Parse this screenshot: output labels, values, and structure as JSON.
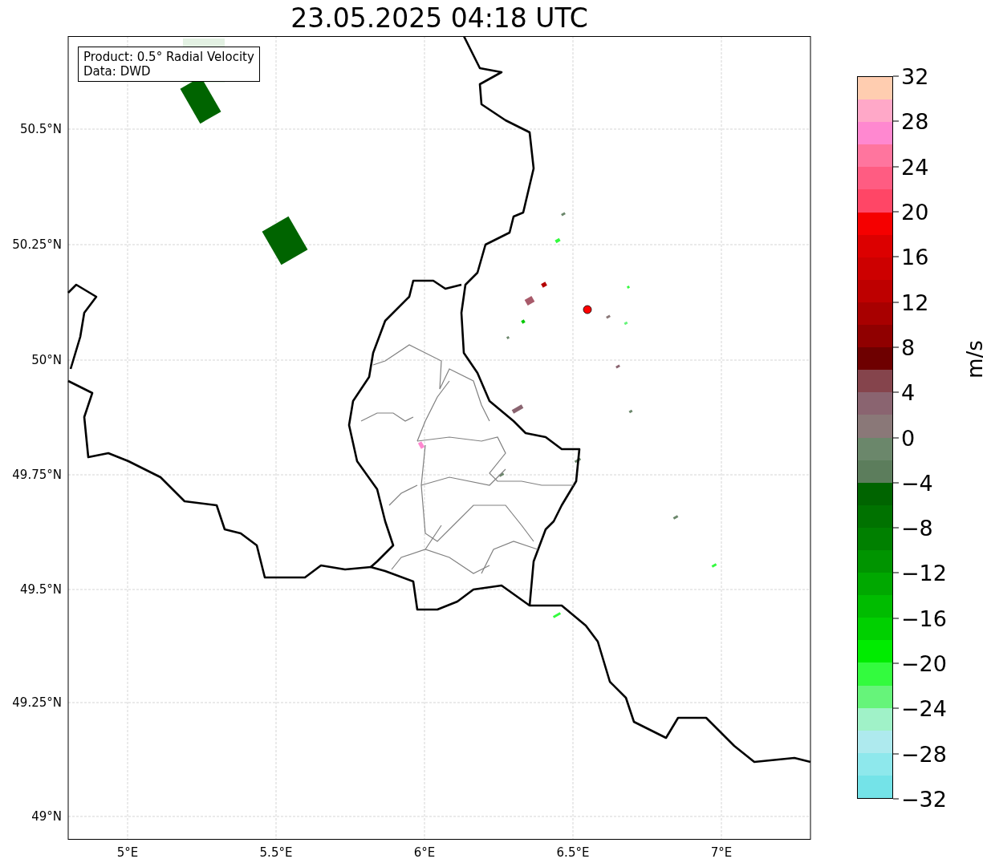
{
  "title": "23.05.2025 04:18 UTC",
  "info_box": {
    "lines": [
      "Product: 0.5° Radial Velocity",
      "Data: DWD"
    ]
  },
  "y_ticks": [
    "50.5°N",
    "50.25°N",
    "50°N",
    "49.75°N",
    "49.5°N",
    "49.25°N",
    "49°N"
  ],
  "x_ticks": [
    "5°E",
    "5.5°E",
    "6°E",
    "6.5°E",
    "7°E"
  ],
  "colorbar": {
    "label": "m/s",
    "ticks": [
      "32",
      "28",
      "24",
      "20",
      "16",
      "12",
      "8",
      "4",
      "0",
      "−4",
      "−8",
      "−12",
      "−16",
      "−20",
      "−24",
      "−28",
      "−32"
    ],
    "bands": [
      {
        "color": "#ffcdb0"
      },
      {
        "color": "#ffa8c8"
      },
      {
        "color": "#ff88d0"
      },
      {
        "color": "#ff759e"
      },
      {
        "color": "#ff5c82"
      },
      {
        "color": "#ff4666"
      },
      {
        "color": "#f50000"
      },
      {
        "color": "#dc0000"
      },
      {
        "color": "#cd0000"
      },
      {
        "color": "#be0000"
      },
      {
        "color": "#a80000"
      },
      {
        "color": "#900000"
      },
      {
        "color": "#6e0000"
      },
      {
        "color": "#85444c"
      },
      {
        "color": "#8a6470"
      },
      {
        "color": "#8a7878"
      },
      {
        "color": "#6b876b"
      },
      {
        "color": "#5c7d5c"
      },
      {
        "color": "#006400"
      },
      {
        "color": "#007200"
      },
      {
        "color": "#008000"
      },
      {
        "color": "#009400"
      },
      {
        "color": "#00a800"
      },
      {
        "color": "#00bc00"
      },
      {
        "color": "#00d000"
      },
      {
        "color": "#00ec00"
      },
      {
        "color": "#33fb3e"
      },
      {
        "color": "#66f47a"
      },
      {
        "color": "#a0f2c8"
      },
      {
        "color": "#aeeaee"
      },
      {
        "color": "#8ee8ec"
      },
      {
        "color": "#74e3e8"
      }
    ]
  }
}
